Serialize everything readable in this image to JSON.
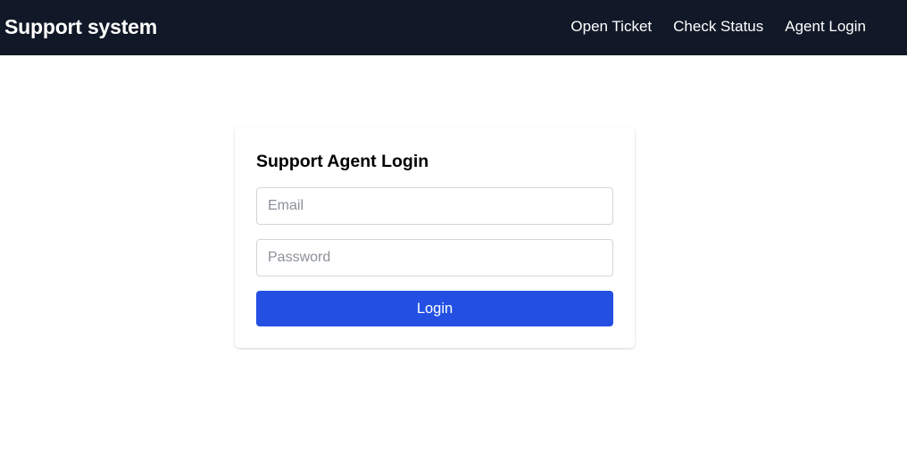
{
  "header": {
    "brand": "Support system",
    "nav": [
      {
        "label": "Open Ticket"
      },
      {
        "label": "Check Status"
      },
      {
        "label": "Agent Login"
      }
    ]
  },
  "login_form": {
    "title": "Support Agent Login",
    "email": {
      "value": "",
      "placeholder": "Email"
    },
    "password": {
      "value": "",
      "placeholder": "Password"
    },
    "submit_label": "Login"
  },
  "colors": {
    "navbar_bg": "#111827",
    "accent": "#2350e3",
    "field_border": "#d1d5db"
  }
}
